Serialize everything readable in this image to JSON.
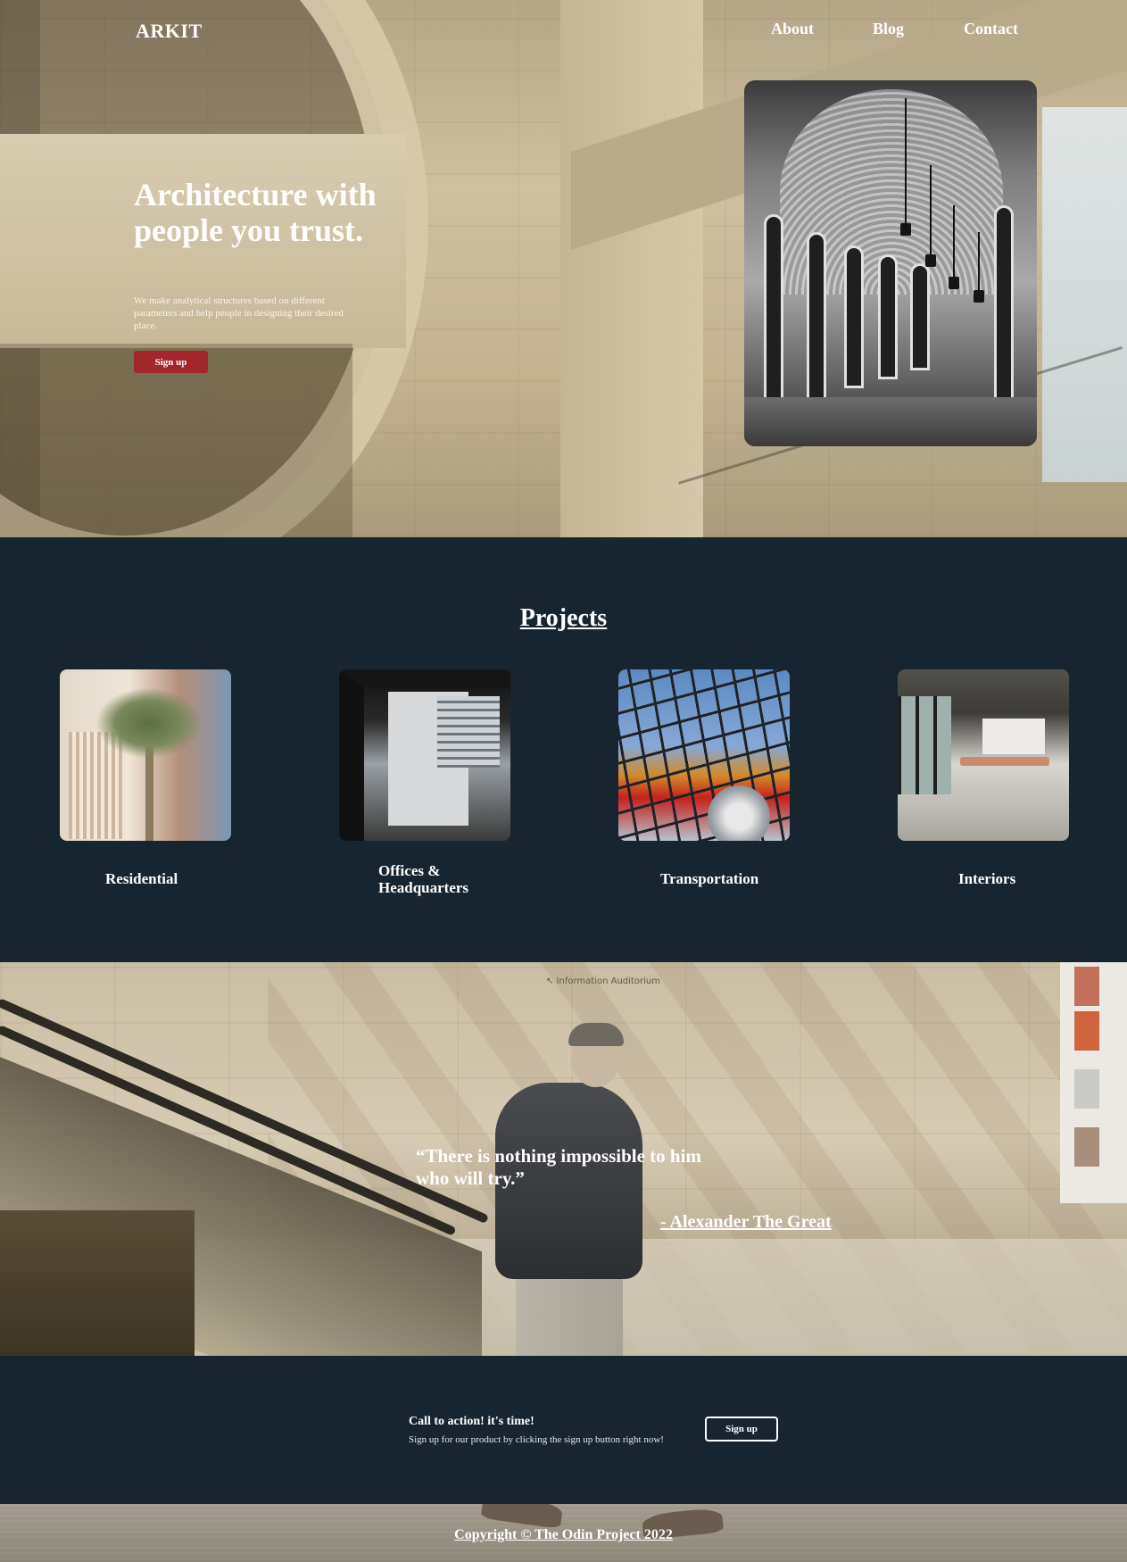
{
  "header": {
    "logo": "ARKIT",
    "nav": [
      "About",
      "Blog",
      "Contact"
    ]
  },
  "hero": {
    "title": "Architecture with people you trust.",
    "text": "We make analytical structures based on different parameters and help people in designing their desired place.",
    "button_label": "Sign up"
  },
  "projects": {
    "title": "Projects",
    "items": [
      {
        "label": "Residential",
        "image": "palm-tree-residential-building"
      },
      {
        "label": "Offices & Headquarters",
        "image": "office-building-courtyard"
      },
      {
        "label": "Transportation",
        "image": "glass-roof-station"
      },
      {
        "label": "Interiors",
        "image": "office-interior"
      }
    ]
  },
  "quote": {
    "text": "“There is nothing impossible to him who will try.”",
    "author": "- Alexander The Great",
    "sign": "↖ Information Auditorium"
  },
  "cta": {
    "title": "Call to action! it's time!",
    "text": "Sign up for our product by clicking the sign up button right now!",
    "button_label": "Sign up"
  },
  "footer": {
    "text": "Copyright © The Odin Project 2022"
  },
  "colors": {
    "dark_bg": "#172530",
    "accent_button": "#a3262a",
    "text": "#ffffff"
  }
}
